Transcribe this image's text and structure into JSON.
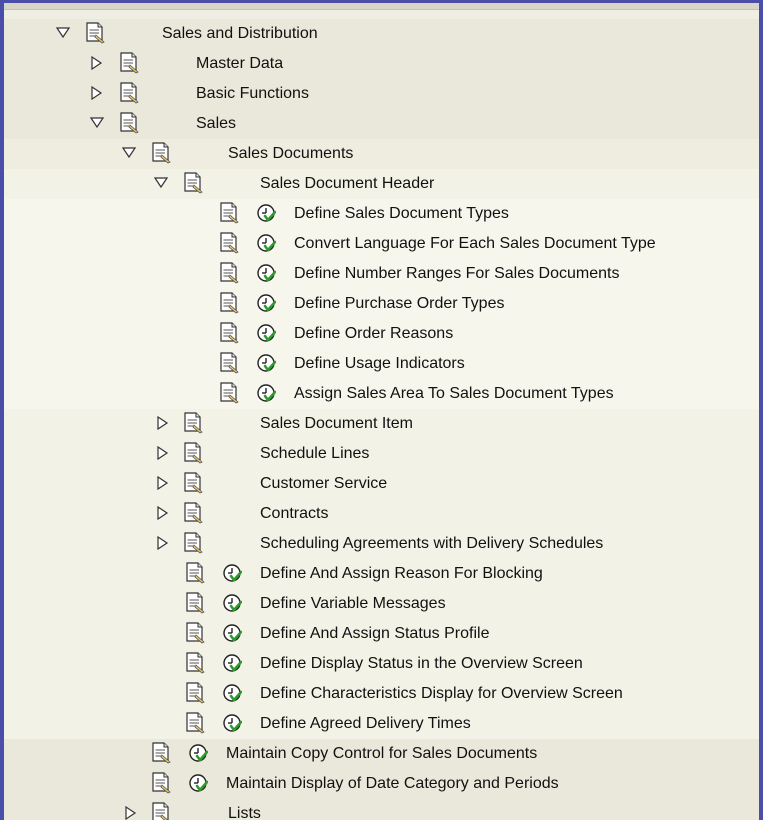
{
  "tree": {
    "nodes": [
      {
        "label": "Sales and Distribution",
        "type": "folder",
        "state": "expanded"
      },
      {
        "label": "Master Data",
        "type": "folder",
        "state": "collapsed"
      },
      {
        "label": "Basic Functions",
        "type": "folder",
        "state": "collapsed"
      },
      {
        "label": "Sales",
        "type": "folder",
        "state": "expanded"
      },
      {
        "label": "Sales Documents",
        "type": "folder",
        "state": "expanded"
      },
      {
        "label": "Sales Document Header",
        "type": "folder",
        "state": "expanded"
      },
      {
        "label": "Define Sales Document Types",
        "type": "activity"
      },
      {
        "label": "Convert Language For Each Sales Document Type",
        "type": "activity"
      },
      {
        "label": "Define Number Ranges For Sales Documents",
        "type": "activity"
      },
      {
        "label": "Define Purchase Order Types",
        "type": "activity"
      },
      {
        "label": "Define Order Reasons",
        "type": "activity"
      },
      {
        "label": "Define Usage Indicators",
        "type": "activity"
      },
      {
        "label": "Assign Sales Area To Sales Document Types",
        "type": "activity"
      },
      {
        "label": "Sales Document Item",
        "type": "folder",
        "state": "collapsed"
      },
      {
        "label": "Schedule Lines",
        "type": "folder",
        "state": "collapsed"
      },
      {
        "label": "Customer Service",
        "type": "folder",
        "state": "collapsed"
      },
      {
        "label": "Contracts",
        "type": "folder",
        "state": "collapsed"
      },
      {
        "label": "Scheduling Agreements with Delivery Schedules",
        "type": "folder",
        "state": "collapsed"
      },
      {
        "label": "Define And Assign Reason For Blocking",
        "type": "activity"
      },
      {
        "label": "Define Variable Messages",
        "type": "activity"
      },
      {
        "label": "Define And Assign Status Profile",
        "type": "activity"
      },
      {
        "label": "Define Display Status in the Overview Screen",
        "type": "activity"
      },
      {
        "label": "Define Characteristics Display for Overview Screen",
        "type": "activity"
      },
      {
        "label": "Define Agreed Delivery Times",
        "type": "activity"
      },
      {
        "label": "Maintain Copy Control for Sales Documents",
        "type": "activity"
      },
      {
        "label": "Maintain Display of Date Category and Periods",
        "type": "activity"
      },
      {
        "label": "Lists",
        "type": "folder",
        "state": "collapsed"
      }
    ],
    "icons": {
      "document": "document-icon",
      "execute": "execute-clock-icon",
      "expanded": "triangle-down-icon",
      "collapsed": "triangle-right-icon"
    },
    "colors": {
      "frame_border": "#4a4ea8",
      "background": "#efeee2",
      "execute_green": "#2e9a2e"
    }
  }
}
